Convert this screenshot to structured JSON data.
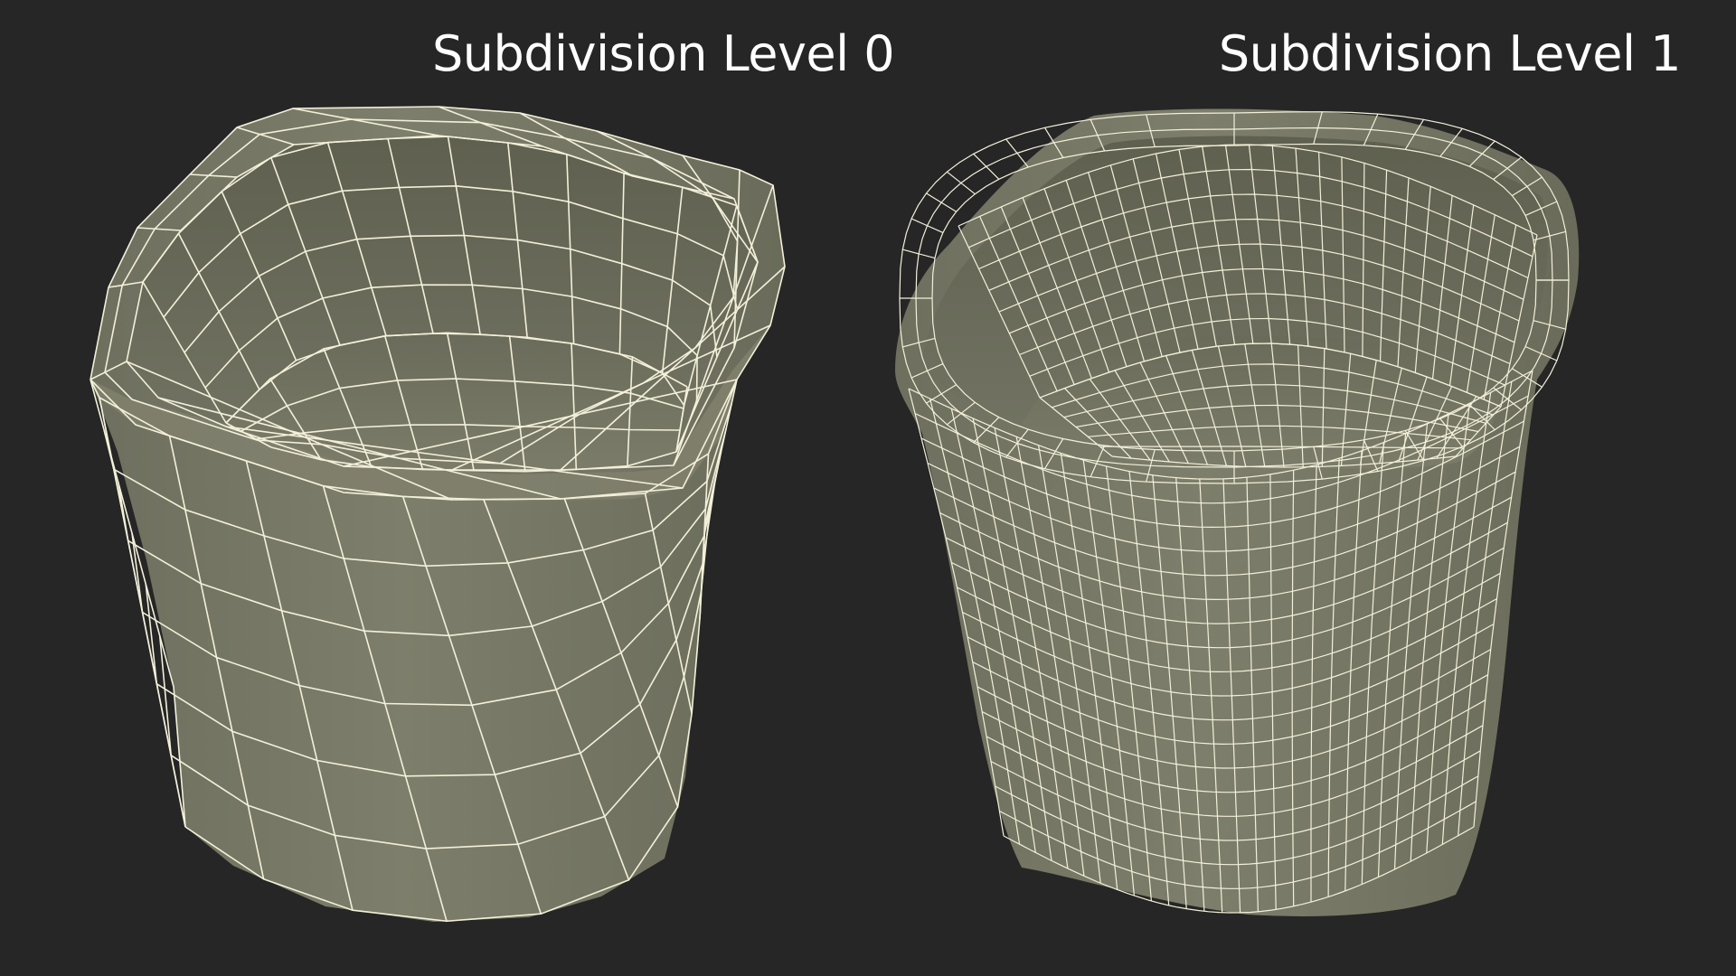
{
  "titles": {
    "left": "Subdivision Level 0",
    "right": "Subdivision Level 1"
  },
  "colors": {
    "background": "#262626",
    "surface": "#7a7b68",
    "surface_inner": "#6a6b5a",
    "surface_shadow": "#5a5b4c",
    "wire": "#f3f0da"
  }
}
